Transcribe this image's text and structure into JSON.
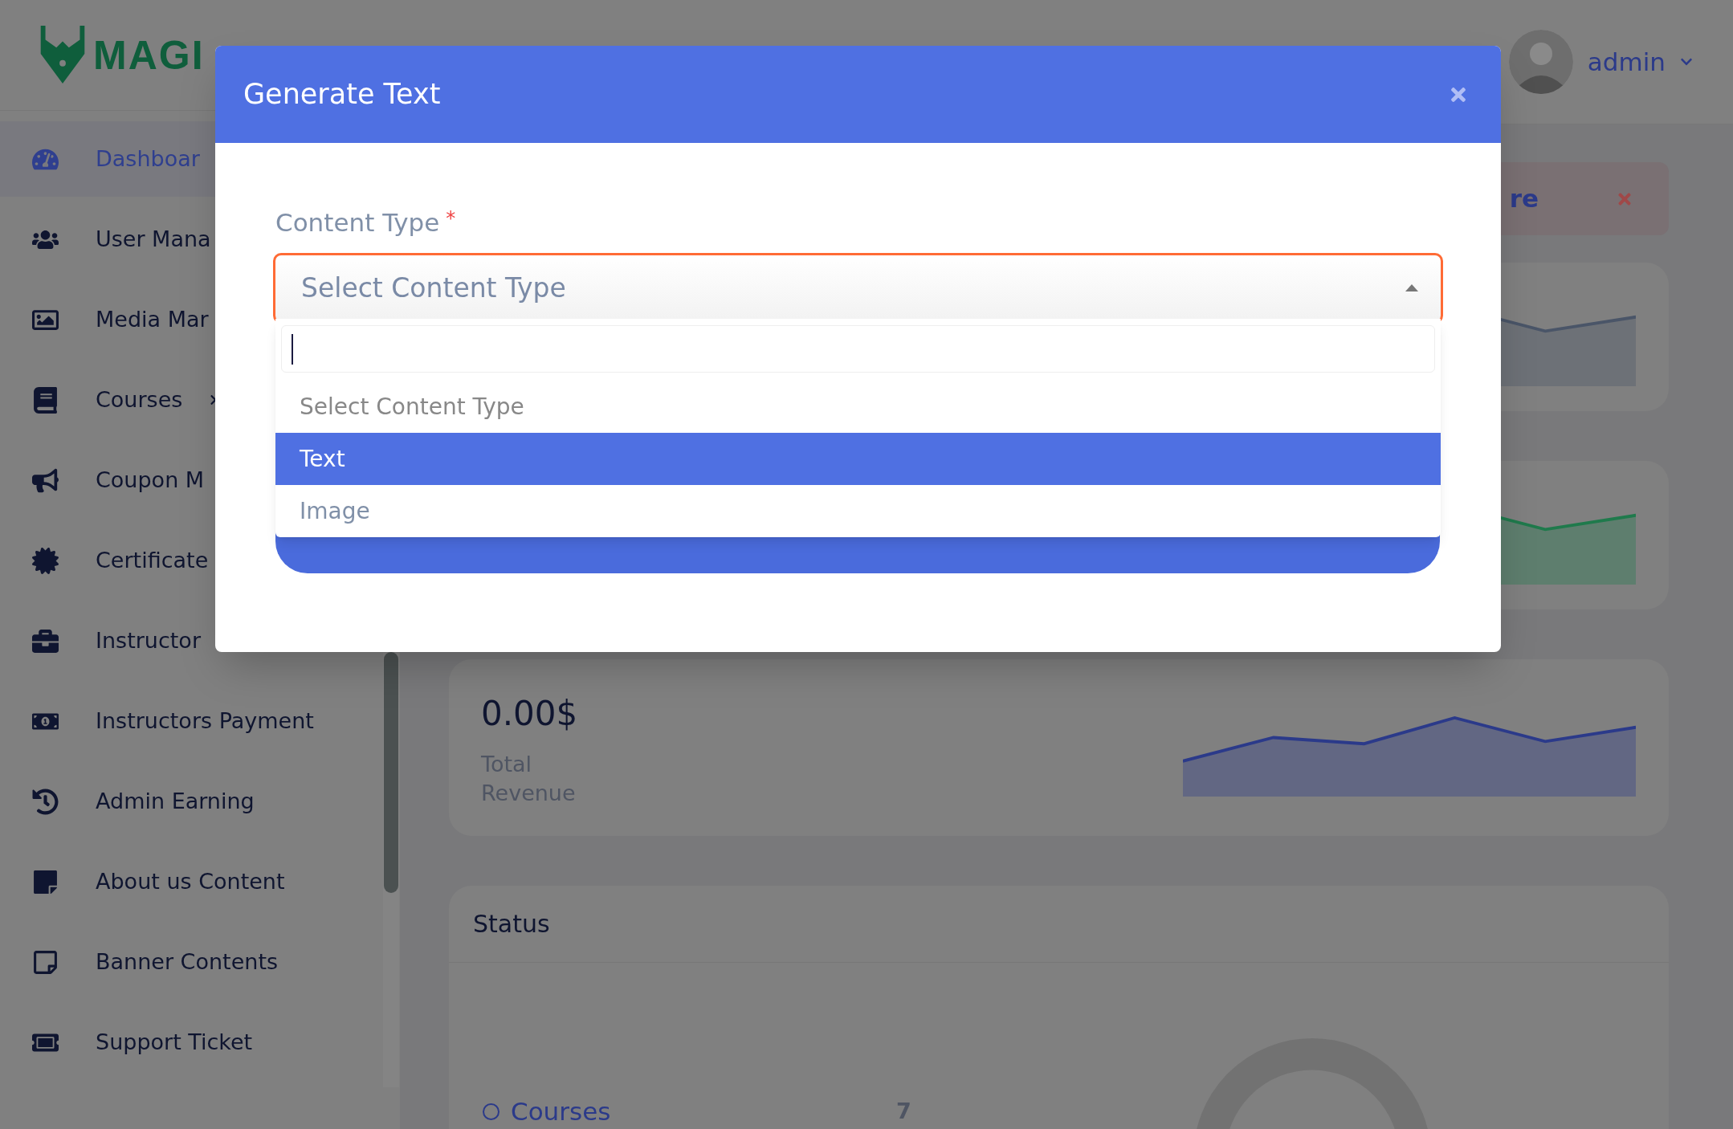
{
  "logo": {
    "text": "MAGI"
  },
  "sidebar": {
    "items": [
      {
        "label": "Dashboar",
        "selected": true
      },
      {
        "label": "User Mana",
        "selected": false
      },
      {
        "label": "Media Mar",
        "selected": false
      },
      {
        "label": "Courses",
        "selected": false,
        "has_submenu": true
      },
      {
        "label": "Coupon M",
        "selected": false
      },
      {
        "label": "Certificate",
        "selected": false
      },
      {
        "label": "Instructor",
        "selected": false
      },
      {
        "label": "Instructors Payment",
        "selected": false
      },
      {
        "label": "Admin Earning",
        "selected": false
      },
      {
        "label": "About us Content",
        "selected": false
      },
      {
        "label": "Banner Contents",
        "selected": false
      },
      {
        "label": "Support Ticket",
        "selected": false
      }
    ]
  },
  "header": {
    "user": "admin"
  },
  "alert": {
    "text": "re"
  },
  "stats": [
    {
      "color": "#4a5568"
    },
    {
      "color": "#1f7a4c"
    },
    {
      "value": "0.00$",
      "label": "Total Revenue",
      "color": "#2b3a8a"
    }
  ],
  "status": {
    "title": "Status",
    "items": [
      {
        "label": "Courses",
        "value": "7"
      }
    ]
  },
  "modal": {
    "title": "Generate Text",
    "field": {
      "label": "Content Type",
      "required_mark": "*",
      "value": "Select Content Type",
      "open": true
    },
    "options": [
      {
        "label": "Select Content Type",
        "selected": false
      },
      {
        "label": "Text",
        "selected": true
      },
      {
        "label": "Image",
        "selected": false
      }
    ]
  }
}
